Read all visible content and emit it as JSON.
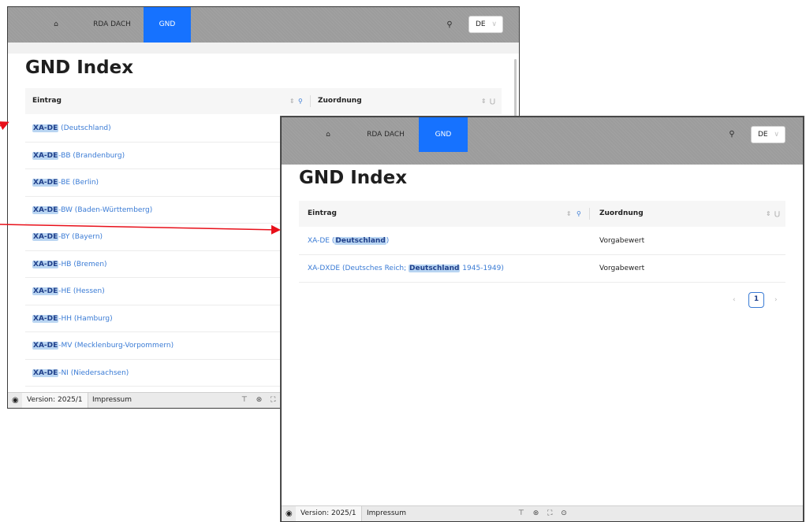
{
  "back_window": {
    "nav": {
      "home_icon": "home-icon",
      "tab_rda": "RDA DACH",
      "tab_gnd": "GND",
      "search_icon": "search-icon",
      "language": "DE"
    },
    "title": "GND Index",
    "table": {
      "col_entry": "Eintrag",
      "col_assignment": "Zuordnung",
      "rows": [
        {
          "code": "XA-DE",
          "rest": " (Deutschland)"
        },
        {
          "code": "XA-DE",
          "rest": "-BB (Brandenburg)"
        },
        {
          "code": "XA-DE",
          "rest": "-BE (Berlin)"
        },
        {
          "code": "XA-DE",
          "rest": "-BW (Baden-Württemberg)"
        },
        {
          "code": "XA-DE",
          "rest": "-BY (Bayern)"
        },
        {
          "code": "XA-DE",
          "rest": "-HB (Bremen)"
        },
        {
          "code": "XA-DE",
          "rest": "-HE (Hessen)"
        },
        {
          "code": "XA-DE",
          "rest": "-HH (Hamburg)"
        },
        {
          "code": "XA-DE",
          "rest": "-MV (Mecklenburg-Vorpommern)"
        },
        {
          "code": "XA-DE",
          "rest": "-NI (Niedersachsen)"
        }
      ]
    },
    "footer": {
      "version": "Version: 2025/1",
      "impressum": "Impressum",
      "tools": "⊤ ⊛ ⛶ ⊙"
    }
  },
  "front_window": {
    "nav": {
      "home_icon": "home-icon",
      "tab_rda": "RDA DACH",
      "tab_gnd": "GND",
      "search_icon": "search-icon",
      "language": "DE"
    },
    "title": "GND Index",
    "table": {
      "col_entry": "Eintrag",
      "col_assignment": "Zuordnung",
      "rows": [
        {
          "pre": "XA-DE (",
          "hl": "Deutschland",
          "post": ")",
          "value": "Vorgabewert"
        },
        {
          "pre": "XA-DXDE (Deutsches Reich; ",
          "hl": "Deutschland",
          "post": " 1945-1949)",
          "value": "Vorgabewert"
        }
      ]
    },
    "pagination": {
      "prev": "‹",
      "current": "1",
      "next": "›"
    },
    "footer": {
      "version": "Version: 2025/1",
      "impressum": "Impressum",
      "tools": "⊤ ⊛ ⛶ ⊙"
    }
  },
  "colors": {
    "accent": "#1672ff",
    "link": "#3a7bd5",
    "highlight": "#b9d5f2",
    "arrow": "#e8101a"
  }
}
